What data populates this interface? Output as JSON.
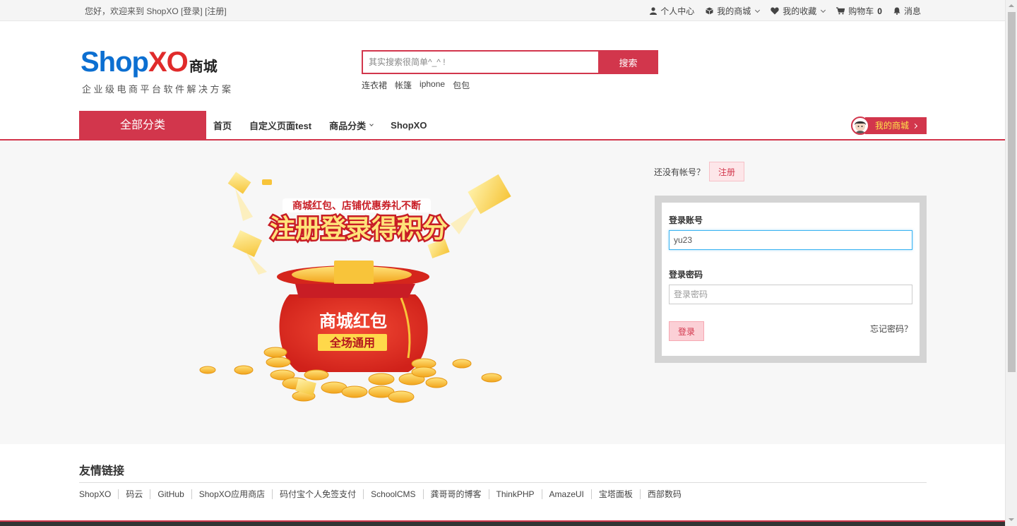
{
  "topbar": {
    "welcome": "您好，欢迎来到 ShopXO",
    "login_link": "[登录]",
    "register_link": "[注册]",
    "personal_center": "个人中心",
    "my_mall": "我的商城",
    "my_favorites": "我的收藏",
    "cart": "购物车",
    "cart_count": "0",
    "messages": "消息"
  },
  "header": {
    "brand_shop": "Shop",
    "brand_xo": "XO",
    "brand_cn": "商城",
    "slogan": "企业级电商平台软件解决方案",
    "search_placeholder": "其实搜索很简单^_^ !",
    "search_button": "搜索",
    "hotwords": [
      "连衣裙",
      "帐篷",
      "iphone",
      "包包"
    ]
  },
  "nav": {
    "all_categories": "全部分类",
    "links": [
      "首页",
      "自定义页面test",
      "商品分类",
      "ShopXO"
    ],
    "my_mall_button": "我的商城"
  },
  "banner": {
    "subtitle": "商城红包、店铺优惠券礼不断",
    "headline": "注册登录得积分",
    "bag_title": "商城红包",
    "bag_tag": "全场通用"
  },
  "login": {
    "no_account": "还没有帐号？",
    "register_button": "注册",
    "account_label": "登录账号",
    "account_value": "yu23",
    "password_label": "登录密码",
    "password_placeholder": "登录密码",
    "submit_button": "登录",
    "forgot": "忘记密码？"
  },
  "friend_links": {
    "title": "友情链接",
    "items": [
      "ShopXO",
      "码云",
      "GitHub",
      "ShopXO应用商店",
      "码付宝个人免签支付",
      "SchoolCMS",
      "龚哥哥的博客",
      "ThinkPHP",
      "AmazeUI",
      "宝塔面板",
      "西部数码"
    ]
  },
  "colors": {
    "accent": "#d2364c",
    "brand_blue": "#0c6fd1",
    "brand_red": "#e02b2b"
  }
}
